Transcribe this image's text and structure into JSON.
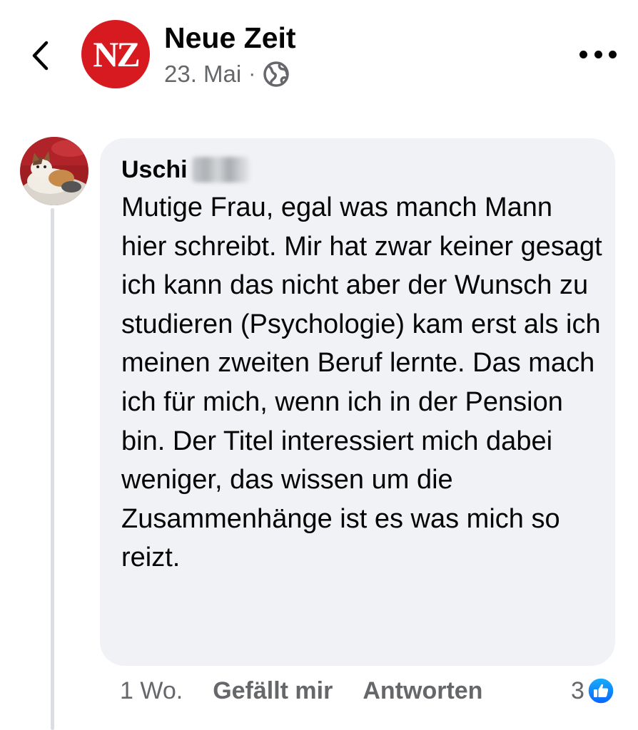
{
  "header": {
    "back_icon": "chevron-left-icon",
    "page_logo_text": "NZ",
    "page_logo_color": "#d71920",
    "page_name": "Neue Zeit",
    "post_date": "23. Mai",
    "separator": "·",
    "audience_icon": "globe-icon",
    "more_icon": "more-horizontal-icon"
  },
  "comment": {
    "author": "Uschi",
    "avatar_icon": "cat-photo-avatar",
    "text": "Mutige Frau, egal was manch Mann hier schreibt. Mir hat zwar keiner gesagt ich kann das nicht aber der Wunsch zu studieren (Psychologie) kam erst als ich meinen zweiten Beruf lernte. Das mach ich für mich, wenn ich in der Pension bin. Der Titel interessiert mich dabei weniger, das wissen um die Zusammenhänge ist es was mich so reizt.",
    "time": "1 Wo.",
    "like_label": "Gefällt mir",
    "reply_label": "Antworten",
    "reaction_count": "3",
    "reaction_icon": "like-thumbs-up-icon",
    "bubble_color": "#f0f2f5",
    "like_color": "#1877f2"
  }
}
